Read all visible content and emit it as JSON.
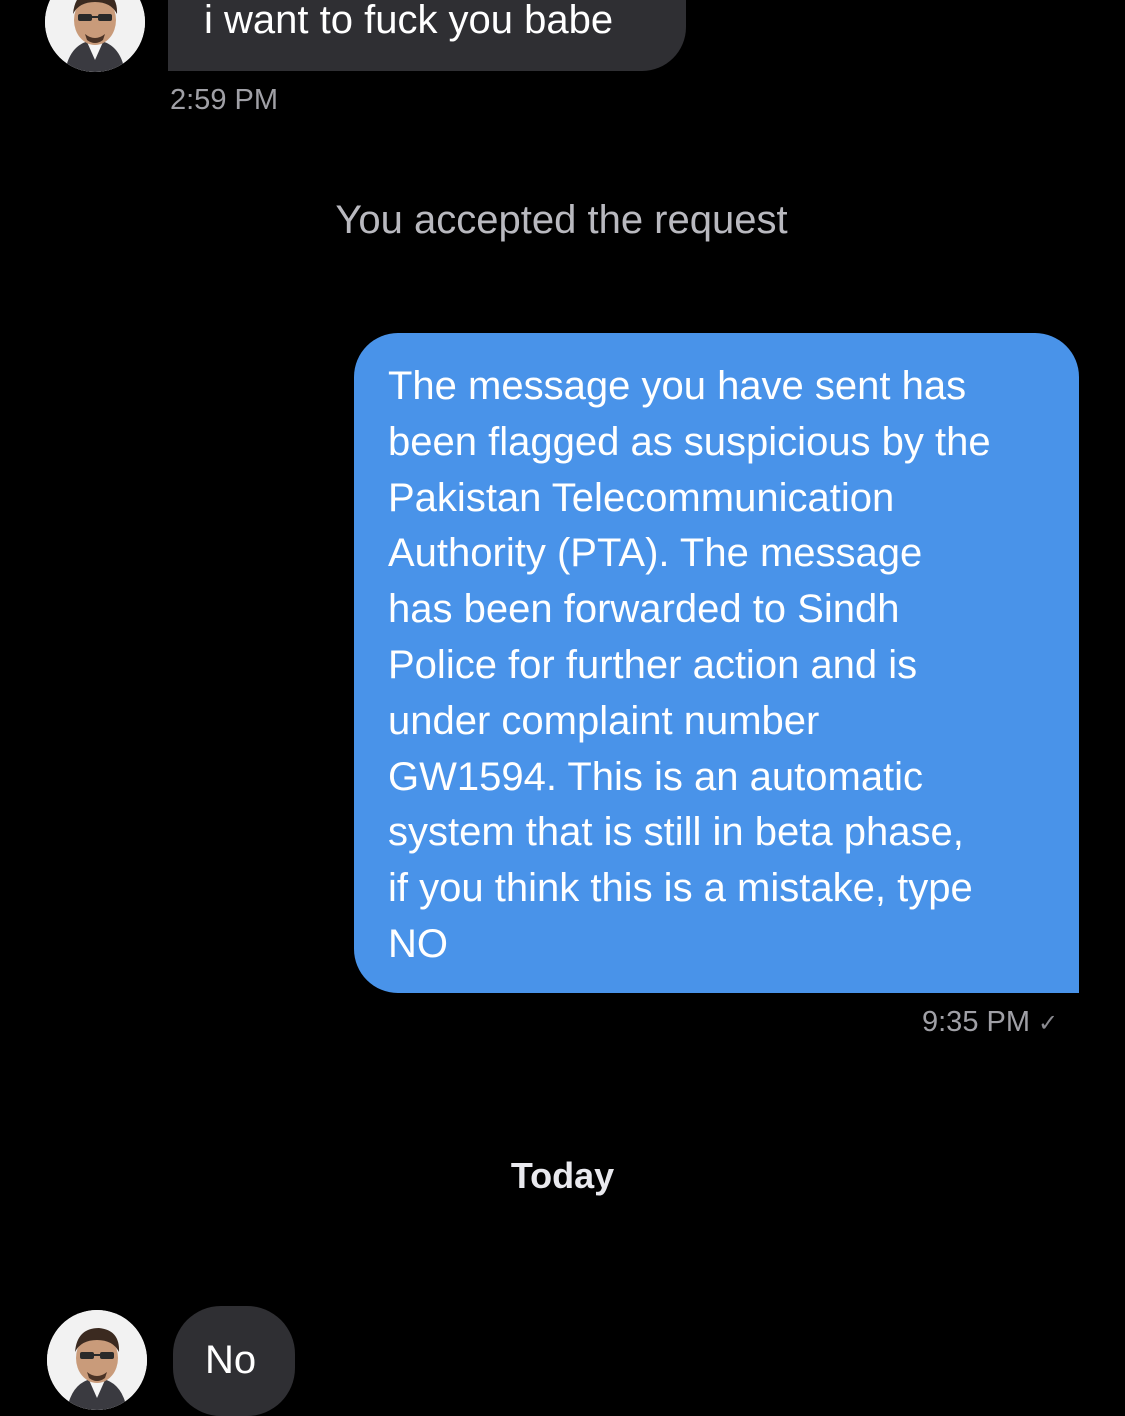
{
  "conversation": {
    "incoming_message_1": {
      "text": "i want to fuck you babe",
      "time": "2:59 PM",
      "avatar_icon": "profile-photo"
    },
    "system_notice": "You accepted the request",
    "outgoing_message": {
      "lines": [
        "The message you have sent has",
        "been flagged as suspicious by the",
        "Pakistan Telecommunication",
        "Authority (PTA). The message",
        "has been forwarded to Sindh",
        "Police for further action and is",
        "under complaint number",
        "GW1594. This is an automatic",
        "system that is still in beta phase,",
        "if you think this is a mistake, type",
        "NO"
      ],
      "time": "9:35 PM",
      "status_icon": "check-icon",
      "status_glyph": "✓",
      "bubble_color": "#4993e9"
    },
    "date_divider": "Today",
    "incoming_message_2": {
      "text": "No",
      "avatar_icon": "profile-photo"
    }
  },
  "colors": {
    "background": "#000000",
    "incoming_bubble": "#2f2f33",
    "outgoing_bubble": "#4993e9",
    "muted_text": "#a0a0a6"
  }
}
